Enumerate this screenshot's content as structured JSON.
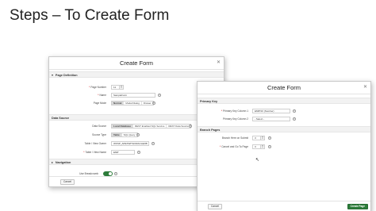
{
  "slide": {
    "title": "Steps – To Create Form"
  },
  "dialog1": {
    "title": "Create Form",
    "sections": {
      "page_definition": "Page Definition",
      "data_source": "Data Source",
      "navigation": "Navigation"
    },
    "page_number": {
      "label": "Page Number",
      "value": "11"
    },
    "name": {
      "label": "Name",
      "value": "SampleForm"
    },
    "page_mode": {
      "label": "Page Mode",
      "options": [
        "Normal",
        "Modal Dialog",
        "Drawer"
      ],
      "selected": "Normal"
    },
    "data_source": {
      "label": "Data Source",
      "options": [
        "Local Database",
        "REST Enabled SQL Service",
        "REST Data Source"
      ],
      "selected": "Local Database"
    },
    "source_type": {
      "label": "Source Type",
      "options": [
        "Table",
        "SQL Query"
      ],
      "selected": "Table"
    },
    "table_view_owner": {
      "label": "Table / View Owner",
      "value": "WKSP_APEXWITHORACLEDB"
    },
    "table_view_name": {
      "label": "Table / View Name",
      "value": "EMP"
    },
    "use_breadcrumb": {
      "label": "Use Breadcrumb",
      "on": true
    },
    "cancel_label": "Cancel"
  },
  "dialog2": {
    "title": "Create Form",
    "sections": {
      "primary_key": "Primary Key",
      "branch_pages": "Branch Pages"
    },
    "pk_column_1": {
      "label": "Primary Key Column 1",
      "value": "EMPNO (Number)"
    },
    "pk_column_2": {
      "label": "Primary Key Column 2",
      "value": "- Select -"
    },
    "branch_here_on_submit": {
      "label": "Branch Here on Submit",
      "value": "3"
    },
    "cancel_go_to_page": {
      "label": "Cancel and Go To Page",
      "value": "3"
    },
    "cancel_label": "Cancel",
    "create_label": "Create Page"
  },
  "colors": {
    "accent": "#2d7c3a"
  }
}
